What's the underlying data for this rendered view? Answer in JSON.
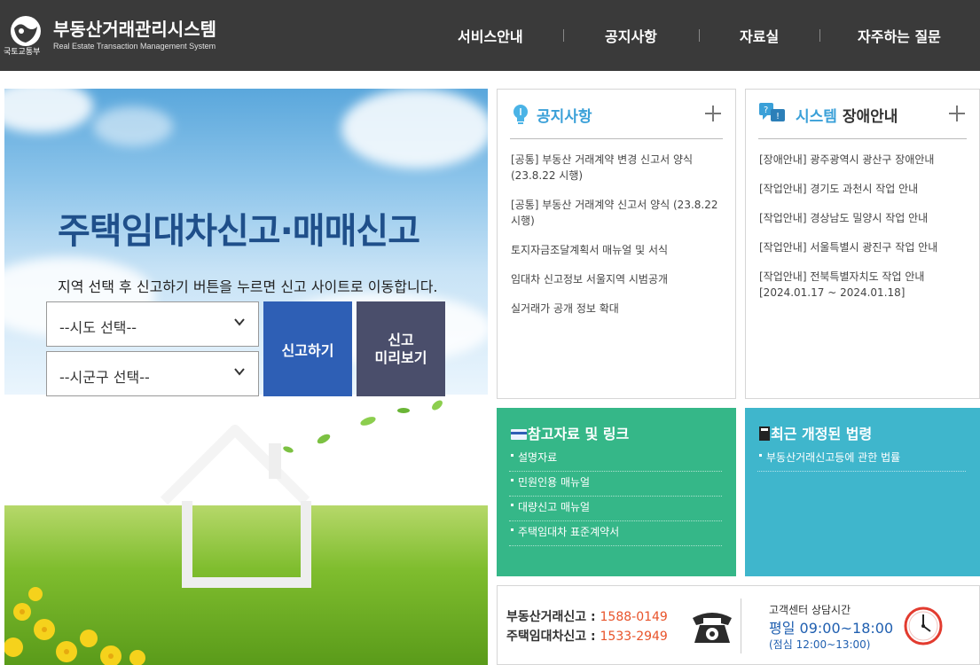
{
  "header": {
    "ministry": "국토교통부",
    "title": "부동산거래관리시스템",
    "subtitle": "Real Estate Transaction Management System",
    "nav": [
      "서비스안내",
      "공지사항",
      "자료실",
      "자주하는 질문"
    ]
  },
  "hero": {
    "title": "주택임대차신고·매매신고",
    "description": "지역 선택 후 신고하기 버튼을 누르면 신고 사이트로 이동합니다.",
    "sido_select": "--시도 선택--",
    "sigungu_select": "--시군구 선택--",
    "report_button": "신고하기",
    "preview_button": "신고\n미리보기"
  },
  "notice": {
    "title": "공지사항",
    "items": [
      "[공통] 부동산 거래계약 변경 신고서 양식 (23.8.22 시행)",
      "[공통] 부동산 거래계약 신고서 양식 (23.8.22 시행)",
      "토지자금조달계획서 매뉴얼 및 서식",
      "임대차 신고정보 서울지역 시범공개",
      "실거래가 공개 정보 확대"
    ]
  },
  "outage": {
    "title_highlight": "시스템",
    "title_rest": " 장애안내",
    "items": [
      "[장애안내] 광주광역시 광산구 장애안내",
      "[작업안내] 경기도 과천시 작업 안내",
      "[작업안내] 경상남도 밀양시 작업 안내",
      "[작업안내] 서울특별시 광진구 작업 안내",
      "[작업안내] 전북특별자치도 작업 안내 [2024.01.17 ~ 2024.01.18]"
    ]
  },
  "reference": {
    "title": "참고자료 및 링크",
    "items": [
      "설명자료",
      "민원인용 매뉴얼",
      "대량신고 매뉴얼",
      "주택임대차 표준계약서"
    ]
  },
  "laws": {
    "title": "최근 개정된 법령",
    "items": [
      "부동산거래신고등에 관한 법률"
    ]
  },
  "contact": {
    "real_estate_label": "부동산거래신고 : ",
    "real_estate_number": "1588-0149",
    "lease_label": "주택임대차신고 : ",
    "lease_number": "1533-2949",
    "hours_title": "고객센터 상담시간",
    "hours_time": "평일 09:00~18:00",
    "hours_lunch": "(점심 12:00~13:00)"
  },
  "colors": {
    "header_bg": "#3a3a3a",
    "report_button": "#2e5fb5",
    "preview_button": "#4a4e6b",
    "reference_panel": "#35b788",
    "laws_panel": "#3fb6cc",
    "phone_number": "#e8532a",
    "hours_text": "#1f5fb0",
    "notice_accent": "#3aa0d8"
  },
  "icons": [
    "emblem-icon",
    "lightbulb-icon",
    "question-bubble-icon",
    "card-icon",
    "document-icon",
    "telephone-icon",
    "clock-icon",
    "chevron-down-icon",
    "plus-icon"
  ]
}
